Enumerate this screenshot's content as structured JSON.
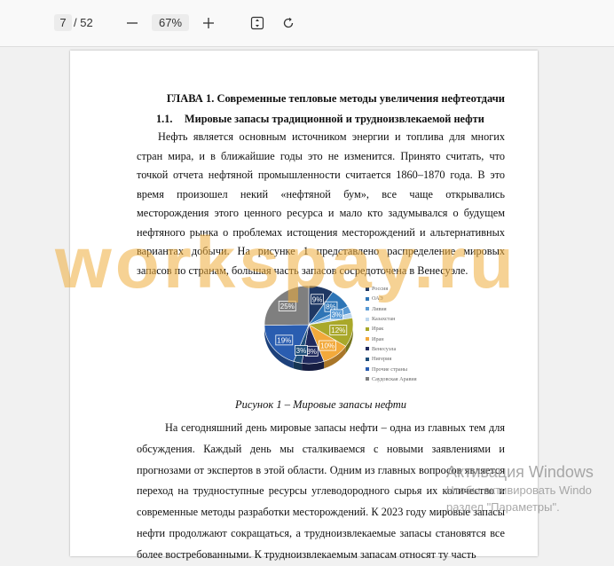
{
  "toolbar": {
    "page_current": "7",
    "page_total": "/ 52",
    "zoom": "67%",
    "icons": [
      "minus-icon",
      "plus-icon",
      "fit-page-icon",
      "rotate-icon"
    ]
  },
  "document": {
    "chapter_title": "ГЛАВА 1. Современные тепловые методы увеличения нефтеотдачи",
    "section_number": "1.1.",
    "section_title": "Мировые запасы традиционной и трудноизвлекаемой нефти",
    "paragraph1": "Нефть является основным источником энергии и топлива для многих стран мира, и в ближайшие годы это не изменится. Принято считать, что точкой отчета нефтяной промышленности считается 1860–1870  года. В это время произошел некий «нефтяной бум», все чаще открывались месторождения этого ценного ресурса и мало кто задумывался о будущем нефтяного рынка о проблемах истощения месторождений и альтернативных вариантах добычи. На рисунке 1 представлено распределение мировых запасов по странам, большая часть запасов сосредоточена в Венесуэле.",
    "figure_caption": "Рисунок 1 – Мировые запасы нефти",
    "paragraph2": "На сегодняшний день мировые запасы нефти – одна из главных тем для обсуждения. Каждый день мы сталкиваемся с новыми заявлениями и прогнозами от экспертов в этой области. Одним из главных вопросов является переход на трудноступные ресурсы углеводородного сырья их количество и современные методы разработки месторождений. К 2023 году мировые запасы нефти продолжают сокращаться, а трудноизвлекаемые запасы становятся все более востребованными.  К трудноизвлекаемым запасам относят ту часть"
  },
  "chart_data": {
    "type": "pie",
    "categories": [
      "Россия",
      "ОАЭ",
      "Ливия",
      "Казахстан",
      "Ирак",
      "Иран",
      "Венесуэла",
      "Нигерия",
      "Прочие страны",
      "Саудовская Аравия"
    ],
    "values": [
      9,
      8,
      3,
      2,
      12,
      10,
      8,
      3,
      19,
      25
    ],
    "labels": [
      "9%",
      "8%",
      "3%",
      "",
      "12%",
      "10%",
      "8%",
      "3%",
      "19%",
      "25%"
    ],
    "colors": [
      "#1f3864",
      "#2e75b6",
      "#5b9bd5",
      "#bdd7ee",
      "#a9a82a",
      "#f2a93b",
      "#202a5e",
      "#1f4e79",
      "#2a5db0",
      "#7f7f7f"
    ],
    "legend_position": "right"
  },
  "watermark": "workspay.ru",
  "os_overlay": {
    "line1": "Активация Windows",
    "line2": "Чтобы активировать Windo",
    "line3": "раздел \"Параметры\"."
  }
}
